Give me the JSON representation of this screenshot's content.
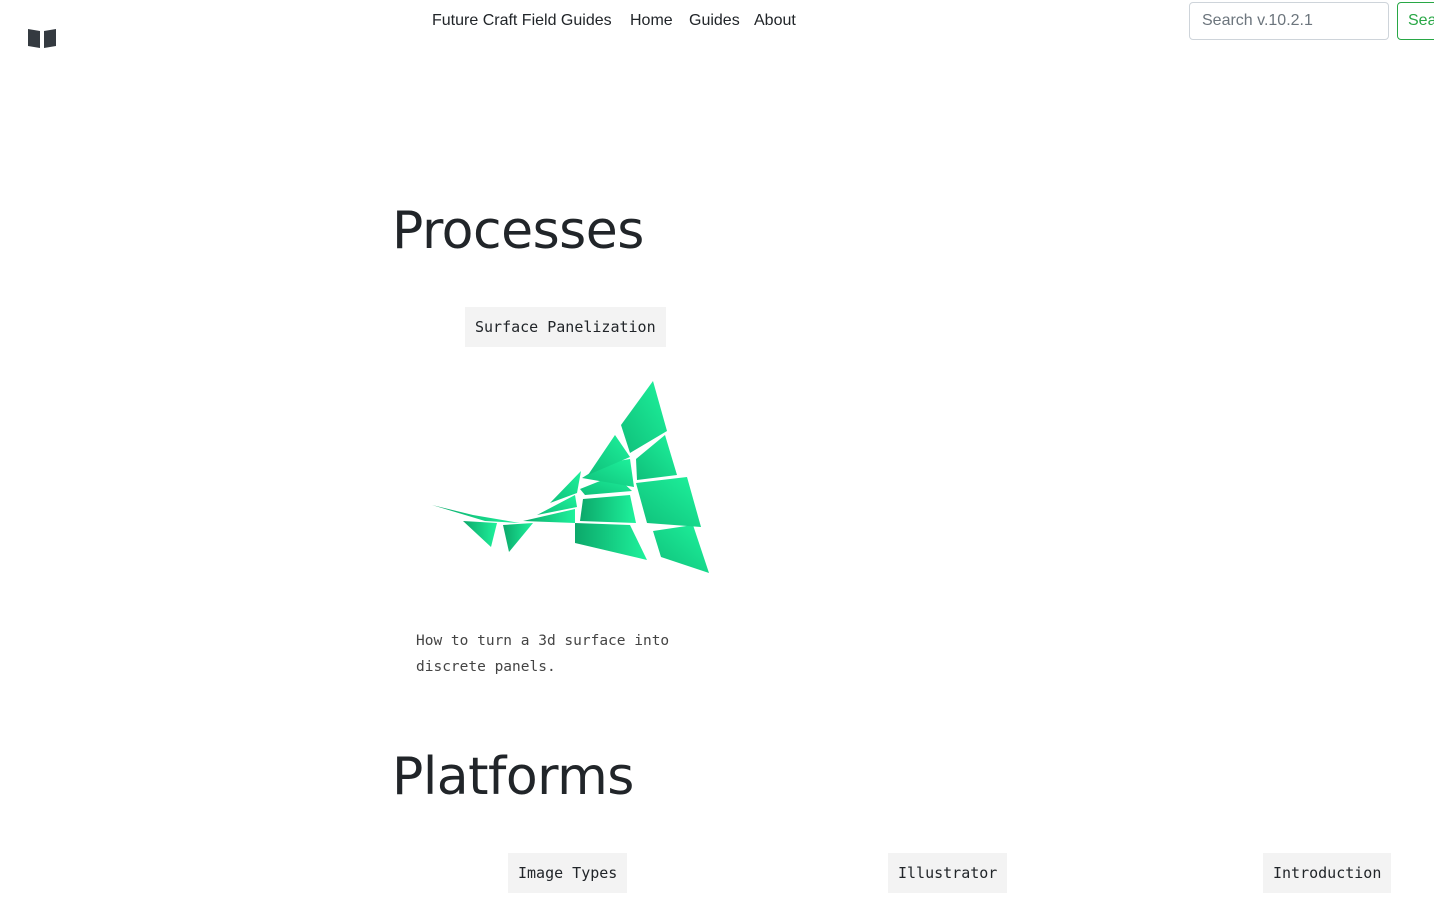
{
  "navbar": {
    "logo_icon": "open-book-icon",
    "brand": "Future Craft Field Guides",
    "links": [
      "Home",
      "Guides",
      "About"
    ],
    "search": {
      "placeholder": "Search v.10.2.1",
      "button_label": "Search"
    }
  },
  "sections": {
    "processes": {
      "title": "Processes",
      "card": {
        "tag": "Surface Panelization",
        "description": "How to turn a 3d surface into discrete panels.",
        "image_icon": "panelized-surface-illustration"
      }
    },
    "platforms": {
      "title": "Platforms",
      "tags": [
        "Image Types",
        "Illustrator",
        "Introduction"
      ]
    }
  },
  "colors": {
    "accent_green": "#1ef29c",
    "search_button": "#28a745",
    "tag_background": "#f3f3f3"
  }
}
